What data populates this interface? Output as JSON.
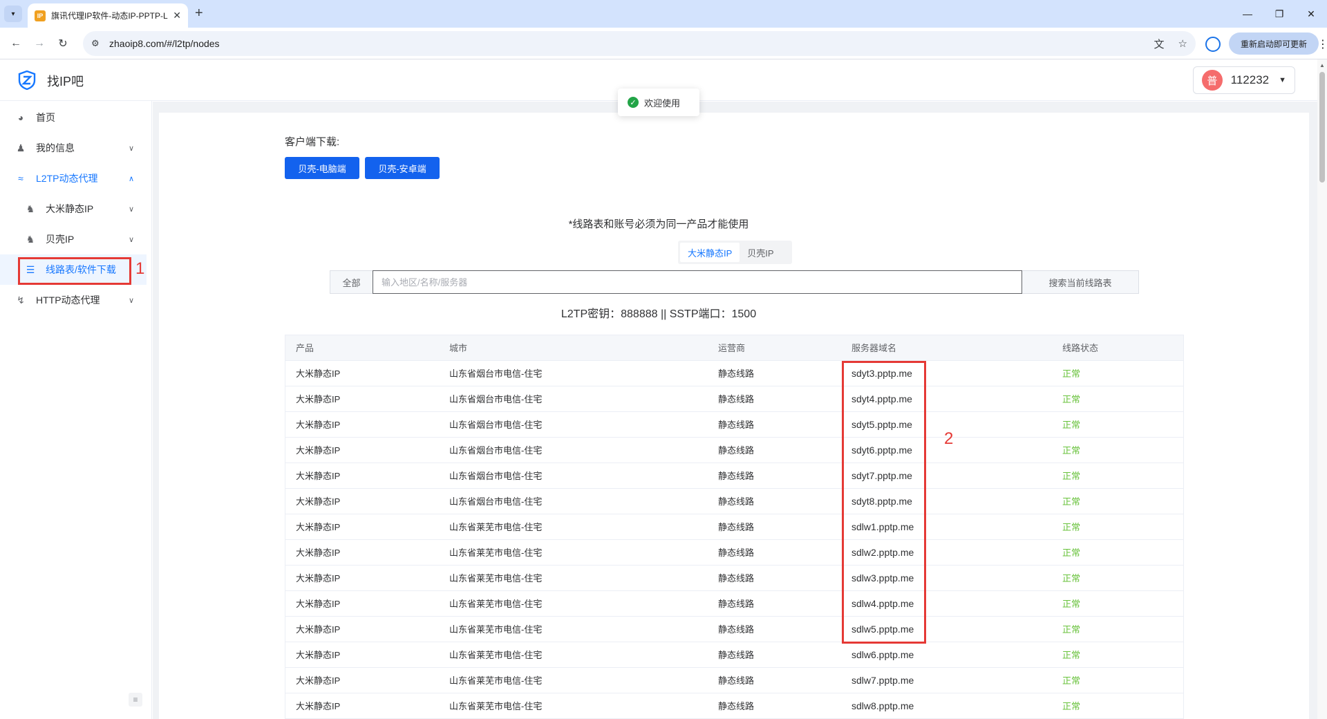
{
  "browser": {
    "tab_title": "旗讯代理IP软件-动态IP-PPTP-L",
    "favicon_text": "IP",
    "url": "zhaoip8.com/#/l2tp/nodes",
    "relaunch_label": "重新启动即可更新"
  },
  "header": {
    "brand": "找IP吧",
    "avatar_char": "普",
    "username": "112232"
  },
  "toast": {
    "text": "欢迎使用"
  },
  "sidebar": {
    "items": [
      {
        "label": "首页",
        "icon": "dashboard-icon"
      },
      {
        "label": "我的信息",
        "icon": "user-icon"
      },
      {
        "label": "L2TP动态代理",
        "icon": "wifi-icon"
      },
      {
        "label": "大米静态IP",
        "icon": "fox-icon"
      },
      {
        "label": "贝壳IP",
        "icon": "fox-icon"
      },
      {
        "label": "线路表/软件下载",
        "icon": "list-icon"
      },
      {
        "label": "HTTP动态代理",
        "icon": "lightning-icon"
      }
    ]
  },
  "annotations": {
    "one": "1",
    "two": "2"
  },
  "download": {
    "label": "客户端下载:",
    "pc_button": "贝壳-电脑端",
    "android_button": "贝壳-安卓端"
  },
  "notice": "*线路表和账号必须为同一产品才能使用",
  "product_tabs": [
    "大米静态IP",
    "贝壳IP"
  ],
  "search": {
    "scope": "全部",
    "placeholder": "输入地区/名称/服务器",
    "button": "搜索当前线路表"
  },
  "key_line": "L2TP密钥：888888 || SSTP端口：1500",
  "table": {
    "columns": [
      "产品",
      "城市",
      "运营商",
      "服务器域名",
      "线路状态"
    ],
    "rows": [
      [
        "大米静态IP",
        "山东省烟台市电信-住宅",
        "静态线路",
        "sdyt3.pptp.me",
        "正常"
      ],
      [
        "大米静态IP",
        "山东省烟台市电信-住宅",
        "静态线路",
        "sdyt4.pptp.me",
        "正常"
      ],
      [
        "大米静态IP",
        "山东省烟台市电信-住宅",
        "静态线路",
        "sdyt5.pptp.me",
        "正常"
      ],
      [
        "大米静态IP",
        "山东省烟台市电信-住宅",
        "静态线路",
        "sdyt6.pptp.me",
        "正常"
      ],
      [
        "大米静态IP",
        "山东省烟台市电信-住宅",
        "静态线路",
        "sdyt7.pptp.me",
        "正常"
      ],
      [
        "大米静态IP",
        "山东省烟台市电信-住宅",
        "静态线路",
        "sdyt8.pptp.me",
        "正常"
      ],
      [
        "大米静态IP",
        "山东省莱芜市电信-住宅",
        "静态线路",
        "sdlw1.pptp.me",
        "正常"
      ],
      [
        "大米静态IP",
        "山东省莱芜市电信-住宅",
        "静态线路",
        "sdlw2.pptp.me",
        "正常"
      ],
      [
        "大米静态IP",
        "山东省莱芜市电信-住宅",
        "静态线路",
        "sdlw3.pptp.me",
        "正常"
      ],
      [
        "大米静态IP",
        "山东省莱芜市电信-住宅",
        "静态线路",
        "sdlw4.pptp.me",
        "正常"
      ],
      [
        "大米静态IP",
        "山东省莱芜市电信-住宅",
        "静态线路",
        "sdlw5.pptp.me",
        "正常"
      ],
      [
        "大米静态IP",
        "山东省莱芜市电信-住宅",
        "静态线路",
        "sdlw6.pptp.me",
        "正常"
      ],
      [
        "大米静态IP",
        "山东省莱芜市电信-住宅",
        "静态线路",
        "sdlw7.pptp.me",
        "正常"
      ],
      [
        "大米静态IP",
        "山东省莱芜市电信-住宅",
        "静态线路",
        "sdlw8.pptp.me",
        "正常"
      ]
    ]
  },
  "colors": {
    "primary": "#1362ee",
    "active_text": "#1677ff",
    "status_ok": "#67c23a",
    "annotation": "#e53935"
  }
}
